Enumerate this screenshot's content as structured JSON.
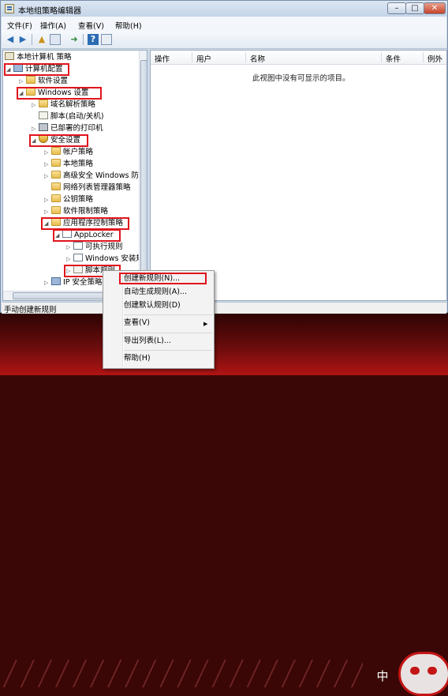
{
  "window": {
    "title": "本地组策略编辑器"
  },
  "caption_buttons": {
    "minimize": "–",
    "maximize": "□",
    "close": "✕"
  },
  "menu": [
    "文件(F)",
    "操作(A)",
    "查看(V)",
    "帮助(H)"
  ],
  "toolbar_icons": [
    "back-icon",
    "forward-icon",
    "up-folder-icon",
    "show-hide-tree-icon",
    "export-list-icon",
    "help-icon",
    "properties-icon"
  ],
  "tree": {
    "root": "本地计算机 策略",
    "computer_config": "计算机配置",
    "software_settings": "软件设置",
    "windows_settings": "Windows 设置",
    "dns_policy": "域名解析策略",
    "scripts": "脚本(启动/关机)",
    "printers": "已部署的打印机",
    "security_settings": "安全设置",
    "account_policies": "帐户策略",
    "local_policies": "本地策略",
    "firewall": "高级安全 Windows 防火",
    "network_list": "网络列表管理器策略",
    "public_key": "公钥策略",
    "software_restriction": "软件限制策略",
    "app_control": "应用程序控制策略",
    "applocker": "AppLocker",
    "exe_rules": "可执行规则",
    "windows_installer": "Windows 安装规",
    "script_rules": "脚本规则",
    "ip_security": "IP 安全策略"
  },
  "columns": [
    "操作",
    "用户",
    "名称",
    "条件",
    "例外"
  ],
  "empty_message": "此视图中没有可显示的项目。",
  "status": "手动创建新规则",
  "context_menu": {
    "create_new_rule": "创建新规则(N)...",
    "auto_generate": "自动生成规则(A)...",
    "create_default": "创建默认规则(D)",
    "view": "查看(V)",
    "export_list": "导出列表(L)...",
    "help": "帮助(H)"
  },
  "desktop": {
    "ime_char": "中"
  },
  "colors": {
    "highlight_box": "#e0141c",
    "titlebar": "#c5d5e8",
    "desktop": "#6a0c0c"
  }
}
